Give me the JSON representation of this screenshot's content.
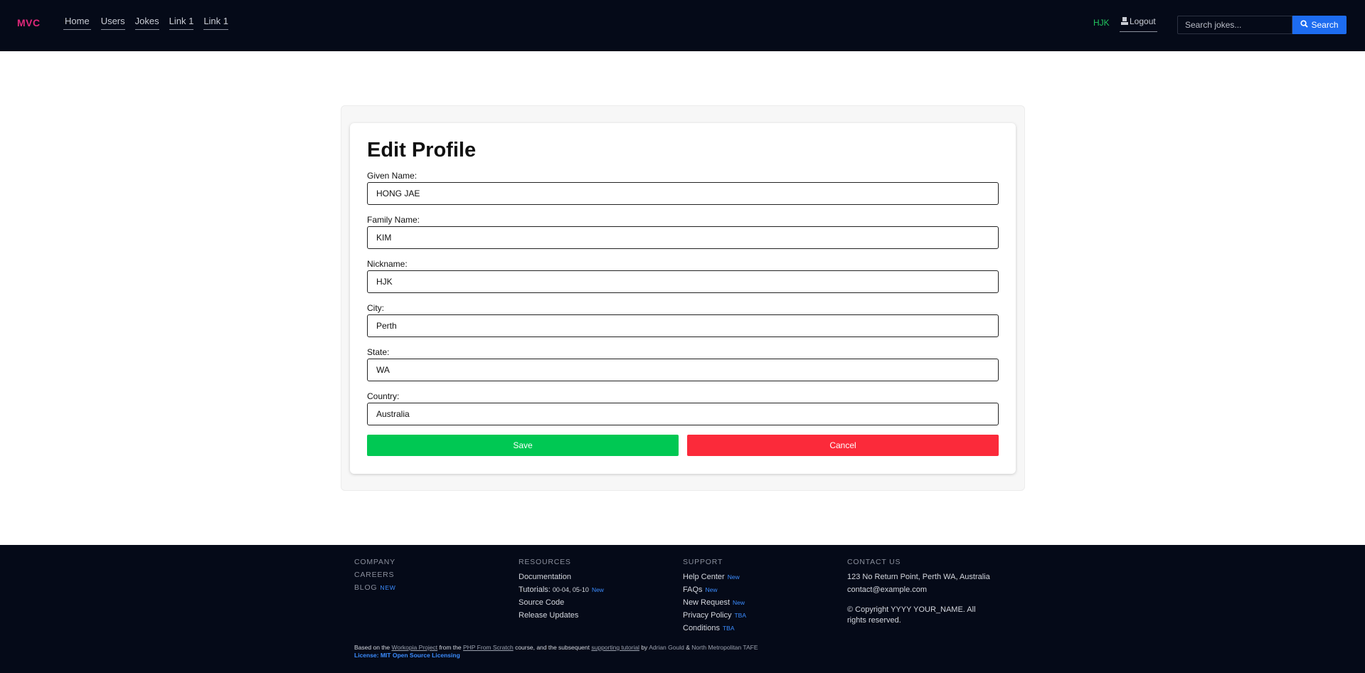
{
  "header": {
    "brand": "MVC",
    "nav": [
      "Home",
      "Users",
      "Jokes",
      "Link 1",
      "Link 1"
    ],
    "user_nickname": "HJK",
    "logout_label": "Logout",
    "search_placeholder": "Search jokes...",
    "search_button": "Search"
  },
  "colors": {
    "header_bg": "#050a18",
    "brand": "#e0287a",
    "nickname": "#22c55e",
    "search_button": "#1d6cf0",
    "save_button": "#00c853",
    "cancel_button": "#fb2a3a"
  },
  "form": {
    "title": "Edit Profile",
    "fields": [
      {
        "label": "Given Name:",
        "value": "HONG JAE"
      },
      {
        "label": "Family Name:",
        "value": "KIM"
      },
      {
        "label": "Nickname:",
        "value": "HJK"
      },
      {
        "label": "City:",
        "value": "Perth"
      },
      {
        "label": "State:",
        "value": "WA"
      },
      {
        "label": "Country:",
        "value": "Australia"
      }
    ],
    "save_label": "Save",
    "cancel_label": "Cancel"
  },
  "footer": {
    "company": [
      "COMPANY",
      "CAREERS",
      "BLOG"
    ],
    "blog_badge": "NEW",
    "resources": {
      "heading": "RESOURCES",
      "documentation": "Documentation",
      "tutorials": "Tutorials:",
      "tutorials_range": "00-04, 05-10",
      "tutorials_badge": "New",
      "source_code": "Source Code",
      "release_updates": "Release Updates"
    },
    "support": {
      "heading": "SUPPORT",
      "items": [
        {
          "label": "Help Center",
          "badge": "New"
        },
        {
          "label": "FAQs",
          "badge": "New"
        },
        {
          "label": "New Request",
          "badge": "New"
        },
        {
          "label": "Privacy Policy",
          "badge": "TBA"
        },
        {
          "label": "Conditions",
          "badge": "TBA"
        }
      ]
    },
    "contact": {
      "heading": "CONTACT US",
      "address": "123 No Return Point, Perth WA, Australia",
      "email": "contact@example.com",
      "copyright": "© Copyright YYYY YOUR_NAME. All rights reserved."
    },
    "credits": {
      "based_on": "Based on the",
      "workopia": "Workopia Project",
      "from_the": "from the",
      "php_course": "PHP From Scratch",
      "course_and": "course, and the subsequent",
      "supporting": "supporting tutorial",
      "by": "by",
      "author": "Adrian Gould",
      "amp": "&",
      "institution": "North Metropolitan TAFE",
      "license": "License: MIT Open Source Licensing"
    }
  }
}
